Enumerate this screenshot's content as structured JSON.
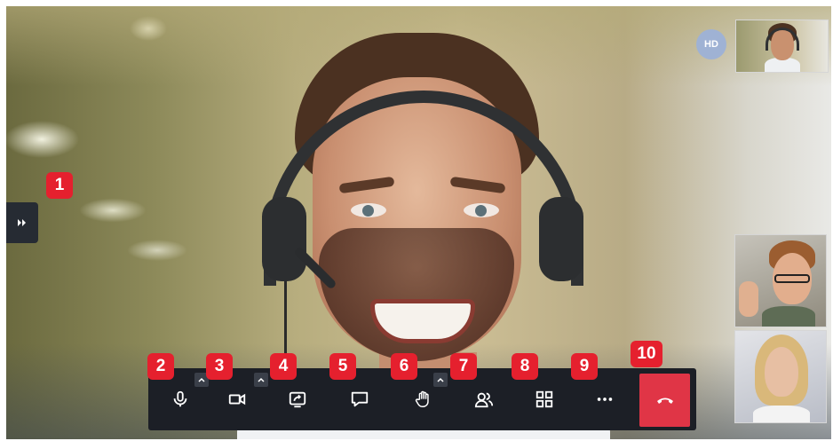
{
  "stage": {
    "hd_label": "HD"
  },
  "markers": [
    "1",
    "2",
    "3",
    "4",
    "5",
    "6",
    "7",
    "8",
    "9",
    "10"
  ],
  "toolbar": {
    "buttons": [
      {
        "icon": "microphone-icon"
      },
      {
        "icon": "camera-icon"
      },
      {
        "icon": "share-screen-icon"
      },
      {
        "icon": "chat-icon"
      },
      {
        "icon": "raise-hand-icon"
      },
      {
        "icon": "participants-icon"
      },
      {
        "icon": "layout-grid-icon"
      },
      {
        "icon": "more-icon"
      },
      {
        "icon": "end-call-icon"
      }
    ],
    "carets": [
      "chevron-up-icon",
      "chevron-up-icon",
      "chevron-up-icon"
    ]
  },
  "side_panel_toggle": {
    "icon": "double-chevron-right-icon"
  },
  "colors": {
    "toolbar_bg": "#1c1f26",
    "end_call": "#e03546",
    "marker": "#e5202e",
    "hd_badge": "#9fb2d4",
    "toggle_bg": "#262b33"
  }
}
